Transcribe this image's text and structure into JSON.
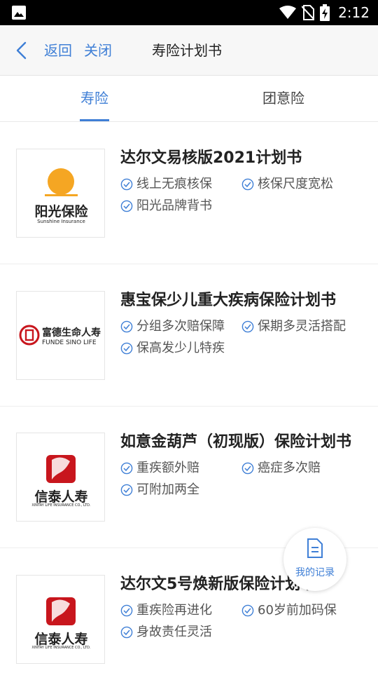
{
  "status_bar": {
    "time": "2:12",
    "icons": [
      "image-icon",
      "wifi-icon",
      "no-sim-icon",
      "battery-charging-icon"
    ]
  },
  "nav": {
    "back": "返回",
    "close": "关闭",
    "title": "寿险计划书"
  },
  "tabs": [
    {
      "label": "寿险",
      "active": true
    },
    {
      "label": "团意险",
      "active": false
    }
  ],
  "colors": {
    "accent": "#3f7fd6",
    "sun": "#f5a623"
  },
  "products": [
    {
      "title": "达尔文易核版2021计划书",
      "logo": {
        "name": "阳光保险",
        "sub": "Sunshine Insurance",
        "icon": "sunshine-logo"
      },
      "features": [
        "线上无痕核保",
        "核保尺度宽松",
        "阳光品牌背书"
      ]
    },
    {
      "title": "惠宝保少儿重大疾病保险计划书",
      "logo": {
        "name": "富德生命人寿",
        "sub": "FUNDE SINO LIFE",
        "icon": "funde-logo"
      },
      "features": [
        "分组多次赔保障",
        "保期多灵活搭配",
        "保高发少儿特疾"
      ]
    },
    {
      "title": "如意金葫芦（初现版）保险计划书",
      "logo": {
        "name": "信泰人寿",
        "sub": "XINTAY LIFE INSURANCE CO., LTD.",
        "icon": "xintai-logo"
      },
      "features": [
        "重疾额外赔",
        "癌症多次赔",
        "可附加两全"
      ]
    },
    {
      "title": "达尔文5号焕新版保险计划书",
      "logo": {
        "name": "信泰人寿",
        "sub": "XINTAY LIFE INSURANCE CO., LTD.",
        "icon": "xintai-logo"
      },
      "features": [
        "重疾险再进化",
        "60岁前加码保",
        "身故责任灵活"
      ]
    }
  ],
  "record_button": {
    "label": "我的记录"
  }
}
